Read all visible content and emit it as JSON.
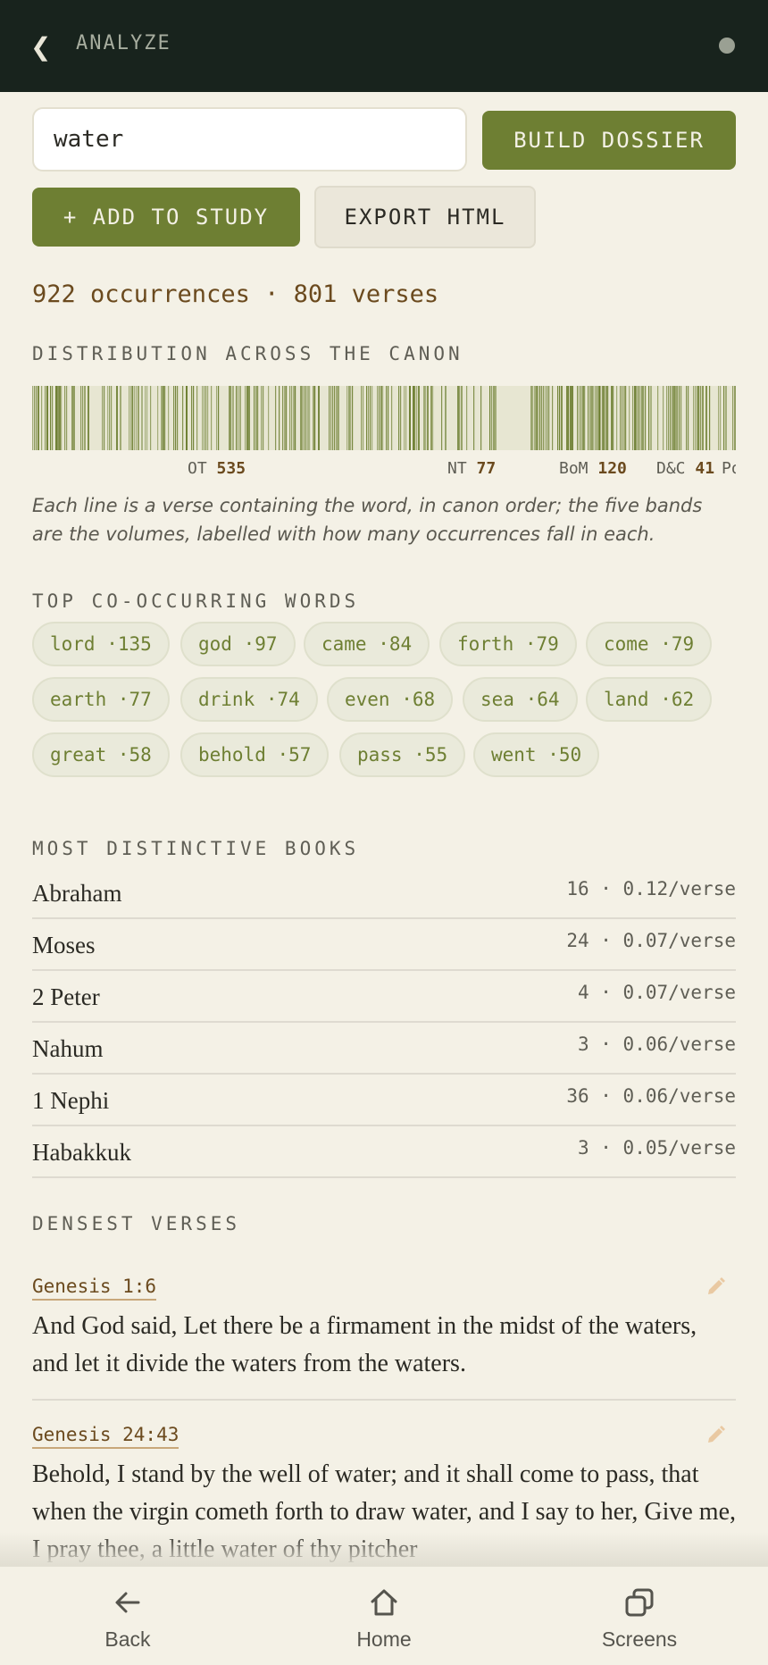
{
  "header": {
    "back_glyph": "❮",
    "title": "ANALYZE"
  },
  "search": {
    "value": "water",
    "build_label": "BUILD DOSSIER"
  },
  "actions": {
    "add_label": "+ ADD TO STUDY",
    "export_label": "EXPORT HTML"
  },
  "summary": "922 occurrences · 801 verses",
  "distribution": {
    "label": "DISTRIBUTION ACROSS THE CANON",
    "bands": [
      {
        "name": "OT",
        "count": "535"
      },
      {
        "name": "NT",
        "count": "77"
      },
      {
        "name": "BoM",
        "count": "120"
      },
      {
        "name": "D&C",
        "count": "41"
      },
      {
        "name": "PoGP",
        "count": ""
      }
    ],
    "caption": "Each line is a verse containing the word, in canon order; the five bands are the volumes, labelled with how many occurrences fall in each.",
    "colors": {
      "bar": "#6e7f33",
      "band_bg": "#e7e6d2"
    }
  },
  "co_words": {
    "label": "TOP CO-OCCURRING WORDS",
    "items": [
      {
        "word": "lord",
        "count": "·135"
      },
      {
        "word": "god",
        "count": "·97"
      },
      {
        "word": "came",
        "count": "·84"
      },
      {
        "word": "forth",
        "count": "·79"
      },
      {
        "word": "come",
        "count": "·79"
      },
      {
        "word": "earth",
        "count": "·77"
      },
      {
        "word": "drink",
        "count": "·74"
      },
      {
        "word": "even",
        "count": "·68"
      },
      {
        "word": "sea",
        "count": "·64"
      },
      {
        "word": "land",
        "count": "·62"
      },
      {
        "word": "great",
        "count": "·58"
      },
      {
        "word": "behold",
        "count": "·57"
      },
      {
        "word": "pass",
        "count": "·55"
      },
      {
        "word": "went",
        "count": "·50"
      }
    ]
  },
  "books": {
    "label": "MOST DISTINCTIVE BOOKS",
    "items": [
      {
        "name": "Abraham",
        "stat": "16 · 0.12/verse"
      },
      {
        "name": "Moses",
        "stat": "24 · 0.07/verse"
      },
      {
        "name": "2 Peter",
        "stat": "4 · 0.07/verse"
      },
      {
        "name": "Nahum",
        "stat": "3 · 0.06/verse"
      },
      {
        "name": "1 Nephi",
        "stat": "36 · 0.06/verse"
      },
      {
        "name": "Habakkuk",
        "stat": "3 · 0.05/verse"
      }
    ]
  },
  "verses": {
    "label": "DENSEST VERSES",
    "items": [
      {
        "ref": "Genesis 1:6",
        "text": "And God said, Let there be a firmament in the midst of the waters, and let it divide the waters from the waters."
      },
      {
        "ref": "Genesis 24:43",
        "text": "Behold, I stand by the well of water; and it shall come to pass, that when the virgin cometh forth to draw water, and I say to her, Give me, I pray thee, a little water of thy pitcher"
      }
    ]
  },
  "nav": {
    "back": "Back",
    "home": "Home",
    "screens": "Screens"
  }
}
